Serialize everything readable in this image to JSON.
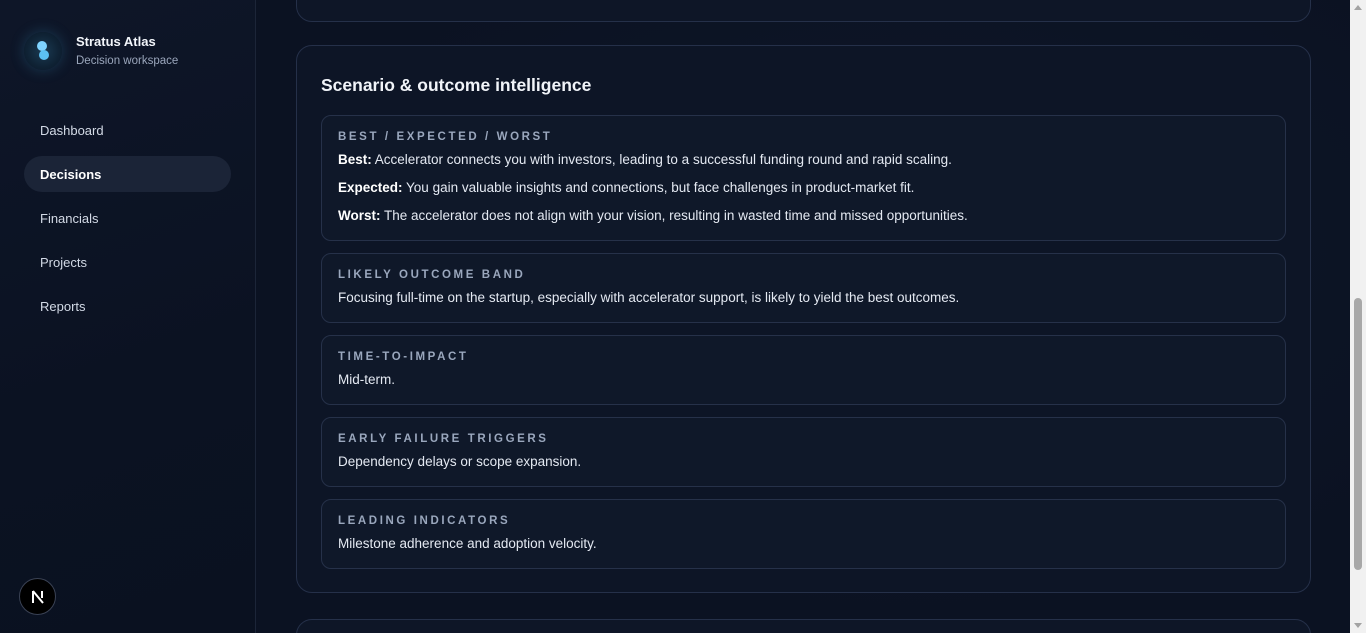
{
  "brand": {
    "name": "Stratus Atlas",
    "subtitle": "Decision workspace"
  },
  "nav": {
    "items": [
      {
        "label": "Dashboard",
        "active": false
      },
      {
        "label": "Decisions",
        "active": true
      },
      {
        "label": "Financials",
        "active": false
      },
      {
        "label": "Projects",
        "active": false
      },
      {
        "label": "Reports",
        "active": false
      }
    ]
  },
  "badge": {
    "letter": "N"
  },
  "card": {
    "title": "Scenario & outcome intelligence",
    "scenarios": {
      "label": "Best / Expected / Worst",
      "best_label": "Best:",
      "best_text": " Accelerator connects you with investors, leading to a successful funding round and rapid scaling.",
      "expected_label": "Expected:",
      "expected_text": " You gain valuable insights and connections, but face challenges in product-market fit.",
      "worst_label": "Worst:",
      "worst_text": " The accelerator does not align with your vision, resulting in wasted time and missed opportunities."
    },
    "sections": [
      {
        "label": "Likely outcome band",
        "body": "Focusing full-time on the startup, especially with accelerator support, is likely to yield the best outcomes."
      },
      {
        "label": "Time-to-impact",
        "body": "Mid-term."
      },
      {
        "label": "Early failure triggers",
        "body": "Dependency delays or scope expansion."
      },
      {
        "label": "Leading indicators",
        "body": "Milestone adherence and adoption velocity."
      }
    ]
  }
}
